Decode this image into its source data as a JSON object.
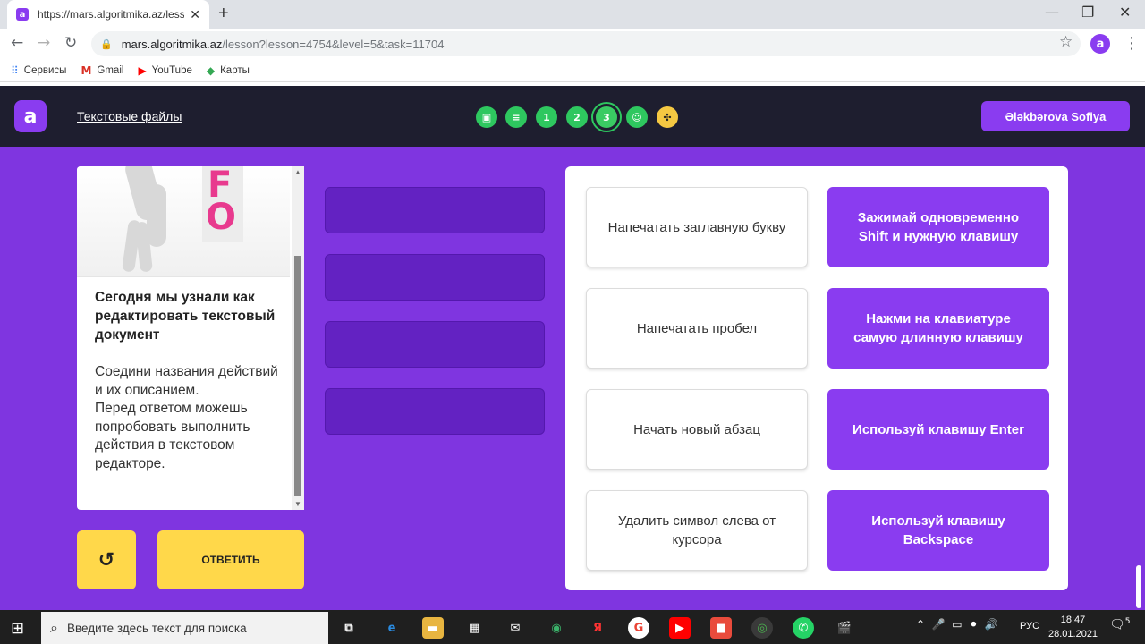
{
  "browser": {
    "tab_title": "https://mars.algoritmika.az/lesso",
    "favicon_letter": "a",
    "url_host": "mars.algoritmika.az",
    "url_path": "/lesson?lesson=4754&level=5&task=11704",
    "profile_letter": "a",
    "bookmarks": [
      {
        "label": "Сервисы",
        "icon": "apps-icon"
      },
      {
        "label": "Gmail",
        "icon": "gmail-icon"
      },
      {
        "label": "YouTube",
        "icon": "youtube-icon"
      },
      {
        "label": "Карты",
        "icon": "maps-icon"
      }
    ]
  },
  "header": {
    "logo_letter": "a",
    "lesson_title": "Текстовые файлы",
    "steps": [
      {
        "label": "",
        "icon": "image-icon"
      },
      {
        "label": "",
        "icon": "document-icon"
      },
      {
        "label": "1"
      },
      {
        "label": "2"
      },
      {
        "label": "3"
      },
      {
        "label": "",
        "icon": "smiley-icon"
      },
      {
        "label": "",
        "icon": "game-icon"
      }
    ],
    "user_name": "Ələkbərova Sofiya"
  },
  "task": {
    "illustration_letters": [
      "F",
      "O"
    ],
    "title": "Сегодня мы узнали как редактировать текстовый документ",
    "instructions": "Соедини названия действий и их описанием.\nПеред ответом можешь попробовать выполнить действия в текстовом редакторе.",
    "reset_icon": "reset-icon",
    "answer_label": "ОТВЕТИТЬ"
  },
  "matching": {
    "actions": [
      "Напечатать заглавную букву",
      "Напечатать пробел",
      "Начать новый абзац",
      "Удалить символ слева от курсора"
    ],
    "descriptions": [
      "Зажимай одновременно Shift и нужную клавишу",
      "Нажми на клавиатуре самую длинную клавишу",
      "Используй клавишу Enter",
      "Используй клавишу Backspace"
    ]
  },
  "taskbar": {
    "search_placeholder": "Введите здесь текст для поиска",
    "language": "РУС",
    "time": "18:47",
    "date": "28.01.2021",
    "notification_count": "5"
  },
  "colors": {
    "brand_purple": "#8a3cf0",
    "main_background": "#7f35e0",
    "slot_purple": "#6322c2",
    "header_dark": "#1e1e2f",
    "step_green": "#2ec75f",
    "button_yellow": "#ffd84a"
  }
}
